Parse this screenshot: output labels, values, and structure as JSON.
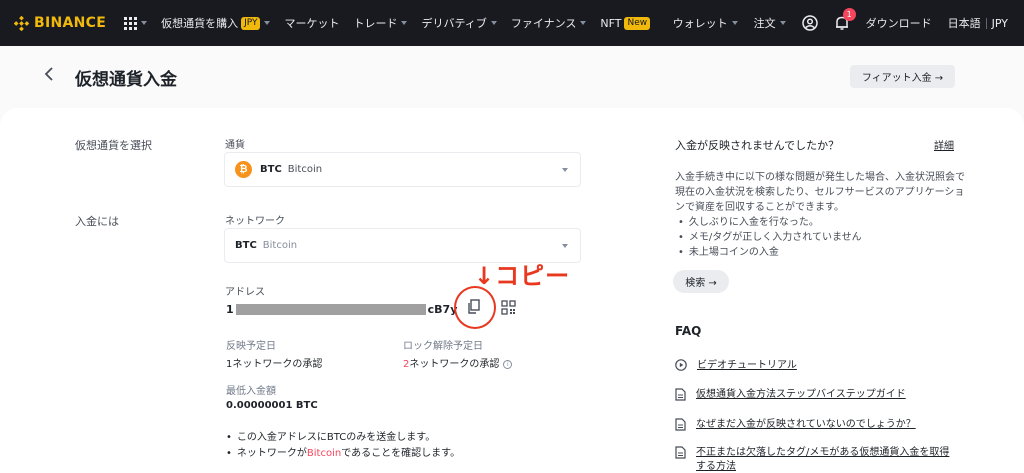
{
  "nav": {
    "logo": "BINANCE",
    "items": [
      {
        "label": "仮想通貨を購入",
        "badge": "JPY"
      },
      {
        "label": "マーケット"
      },
      {
        "label": "トレード"
      },
      {
        "label": "デリバティブ"
      },
      {
        "label": "ファイナンス"
      },
      {
        "label": "NFT",
        "badge": "New"
      }
    ],
    "wallet": "ウォレット",
    "orders": "注文",
    "notification_count": "1",
    "download": "ダウンロード",
    "language": "日本語",
    "currency": "JPY",
    "brand_color": "#f0b90b",
    "background": "#181a20"
  },
  "header": {
    "title": "仮想通貨入金",
    "fiat_button": "フィアット入金 →"
  },
  "form": {
    "select_crypto_label": "仮想通貨を選択",
    "currency_label": "通貨",
    "currency_symbol": "BTC",
    "currency_name": "Bitcoin",
    "deposit_to_label": "入金には",
    "network_label": "ネットワーク",
    "network_symbol": "BTC",
    "network_name": "Bitcoin",
    "address_label": "アドレス",
    "address_start": "1",
    "address_end": "cB7y",
    "copy_annotation": "↓コピー",
    "arrival_label": "反映予定日",
    "arrival_num": "1",
    "arrival_value": "ネットワークの承認",
    "unlock_label": "ロック解除予定日",
    "unlock_num": "2",
    "unlock_value": "ネットワークの承認",
    "min_label": "最低入金額",
    "min_value": "0.00000001 BTC",
    "note1": "この入金アドレスにBTCのみを送金します。",
    "note2_pre": "ネットワークが",
    "note2_link": "Bitcoin",
    "note2_post": "であることを確認します。"
  },
  "help": {
    "title": "入金が反映されませんでしたか？",
    "details_link": "詳細",
    "description": "入金手続き中に以下の様な問題が発生した場合、入金状況照会で現在の入金状況を検索したり、セルフサービスのアプリケーションで資産を回収することができます。",
    "bullets": [
      "久しぶりに入金を行なった。",
      "メモ/タグが正しく入力されていません",
      "未上場コインの入金"
    ],
    "search_button": "検索 →"
  },
  "faq": {
    "title": "FAQ",
    "items": [
      {
        "icon": "play-icon",
        "label": "ビデオチュートリアル"
      },
      {
        "icon": "document-icon",
        "label": "仮想通貨入金方法ステップバイステップガイド"
      },
      {
        "icon": "document-icon",
        "label": "なぜまだ入金が反映されていないのでしょうか？"
      },
      {
        "icon": "document-icon",
        "label": "不正または欠落したタグ/メモがある仮想通貨入金を取得する方法"
      }
    ]
  }
}
